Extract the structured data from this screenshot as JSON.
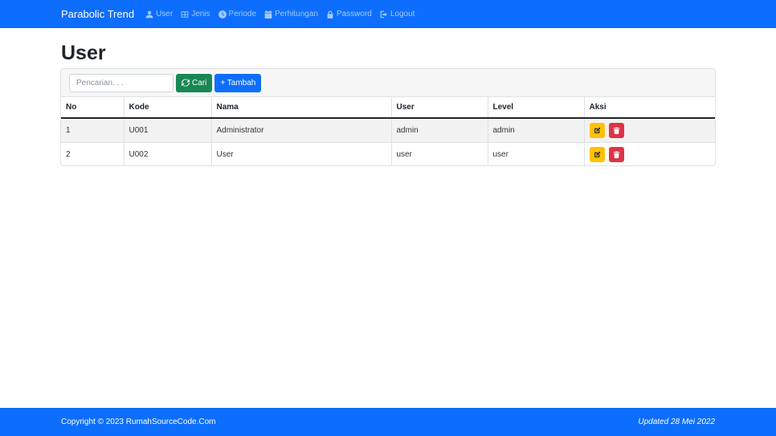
{
  "navbar": {
    "brand": "Parabolic Trend",
    "items": [
      {
        "label": "User",
        "icon": "user-icon"
      },
      {
        "label": "Jenis",
        "icon": "table-icon"
      },
      {
        "label": "Periode",
        "icon": "clock-icon"
      },
      {
        "label": "Perhitungan",
        "icon": "calendar-icon"
      },
      {
        "label": "Password",
        "icon": "lock-icon"
      },
      {
        "label": "Logout",
        "icon": "logout-icon"
      }
    ]
  },
  "page": {
    "title": "User"
  },
  "toolbar": {
    "search_placeholder": "Pencarian. . .",
    "search_value": "",
    "search_button": "Cari",
    "add_button": "+ Tambah"
  },
  "table": {
    "headers": [
      "No",
      "Kode",
      "Nama",
      "User",
      "Level",
      "Aksi"
    ],
    "rows": [
      {
        "no": "1",
        "kode": "U001",
        "nama": "Administrator",
        "user": "admin",
        "level": "admin"
      },
      {
        "no": "2",
        "kode": "U002",
        "nama": "User",
        "user": "user",
        "level": "user"
      }
    ]
  },
  "footer": {
    "copyright": "Copyright © 2023 RumahSourceCode.Com",
    "updated": "Updated 28 Mei 2022"
  },
  "colors": {
    "primary": "#0d6efd",
    "success": "#198754",
    "warning": "#ffc107",
    "danger": "#dc3545"
  }
}
